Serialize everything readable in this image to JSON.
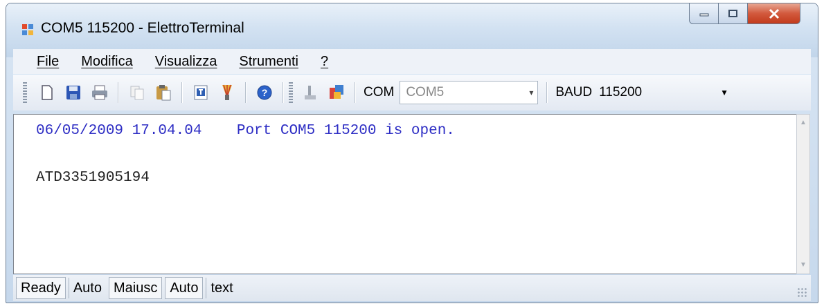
{
  "window": {
    "title": "COM5 115200 - ElettroTerminal",
    "icon": "app-window-icon",
    "controls": [
      "minimize-icon",
      "maximize-icon",
      "close-icon"
    ]
  },
  "menu": {
    "items": [
      {
        "label": "File"
      },
      {
        "label": "Modifica"
      },
      {
        "label": "Visualizza"
      },
      {
        "label": "Strumenti"
      },
      {
        "label": "?"
      }
    ]
  },
  "toolbar": {
    "icons": [
      "new-file-icon",
      "save-icon",
      "print-icon",
      "copy-icon",
      "paste-icon",
      "text-icon",
      "brush-icon",
      "help-icon",
      "connect-icon",
      "disconnect-icon"
    ],
    "com_label": "COM",
    "com_value": "COM5",
    "baud_label": "BAUD",
    "baud_value": "115200"
  },
  "terminal": {
    "lines": [
      {
        "text": "06/05/2009 17.04.04    Port COM5 115200 is open.",
        "color": "#2d2dc4"
      },
      {
        "text": "ATD3351905194",
        "color": "#222222"
      }
    ]
  },
  "statusbar": {
    "panels": [
      "Ready",
      "Auto",
      "Maiusc",
      "Auto",
      "text"
    ]
  }
}
